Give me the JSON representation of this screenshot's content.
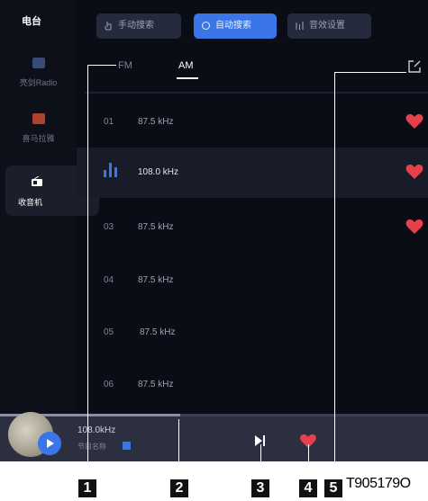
{
  "sidebar": {
    "title": "电台",
    "items": [
      {
        "label": "亮剑Radio",
        "icon": "radio-app-icon",
        "color": "#3a4a7a"
      },
      {
        "label": "喜马拉雅",
        "icon": "himalaya-app-icon",
        "color": "#b04030"
      },
      {
        "label": "收音机",
        "icon": "radio-icon",
        "color": "#ffffff",
        "active": true
      }
    ]
  },
  "toolbar": {
    "manual_search": "手动搜索",
    "auto_search": "自动搜索",
    "sound_settings": "音效设置"
  },
  "tabs": {
    "fm": "FM",
    "am": "AM",
    "active": "AM"
  },
  "stations": [
    {
      "num": "01",
      "freq": "87.5 kHz",
      "favorite": true
    },
    {
      "num": "",
      "freq": "108.0 kHz",
      "favorite": true,
      "playing": true
    },
    {
      "num": "03",
      "freq": "87.5 kHz",
      "favorite": true
    },
    {
      "num": "04",
      "freq": "87.5 kHz",
      "favorite": false
    },
    {
      "num": "05",
      "freq": "87.5 kHz",
      "favorite": false
    },
    {
      "num": "06",
      "freq": "87.5 kHz",
      "favorite": false
    }
  ],
  "player": {
    "freq": "108.0kHz",
    "subtitle": "节目名称",
    "progress": 0.42
  },
  "callouts": [
    "1",
    "2",
    "3",
    "4",
    "5"
  ],
  "figure_ref": "T905179O",
  "colors": {
    "accent": "#3b76e8",
    "heart": "#e8404a",
    "background": "#0b0d16"
  }
}
